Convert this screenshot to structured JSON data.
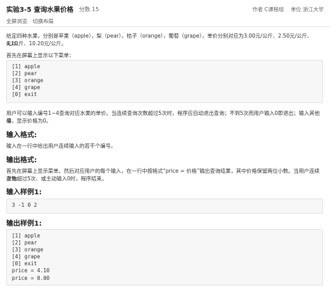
{
  "header": {
    "title": "实验3-5 查询水果价格",
    "score": "分数 15",
    "author": "作者 C课程组",
    "unit": "单位 浙江大学"
  },
  "actions": {
    "fullscreen": "全屏浏览",
    "switch_layout": "切换布局"
  },
  "problem": {
    "desc_line1": "给定四种水果，分别是苹果（apple），梨（pear），桔子（orange），葡萄（grape），单价分别对应为3.00元/公斤、2.50元/公斤、4.10",
    "desc_line2": "元/公斤、10.20元/公斤。",
    "menu_intro": "首先在屏幕上显示以下菜单：",
    "menu_lines": [
      "[1] apple",
      "[2] pear",
      "[3] orange",
      "[4] grape",
      "[0] exit"
    ],
    "rule_line1": "用户可以输入编号1~4查询对应水果的单价。当连续查询次数超过5次时，程序应自动退出查询；不到5次而用户输入0即退出；输入其他编",
    "rule_line2": "号，显示价格为0。",
    "input_format_title": "输入格式:",
    "input_format_text": "输入在一行中给出用户连续输入的若干个编号。",
    "output_format_title": "输出格式:",
    "output_format_line1": "首先在屏幕上显示菜单。然后对应用户的每个输入，在一行中按格式“price = 价格”输出查询结果，其中价格保留两位小数。当用户连续查询",
    "output_format_line2": "次数超过5次、或主动输入0时，程序结束。",
    "sample_input_title": "输入样例1:",
    "sample_input": "3 -1 0 2",
    "sample_output_title": "输出样例1:",
    "sample_output_lines": [
      "[1] apple",
      "[2] pear",
      "[3] orange",
      "[4] grape",
      "[0] exit",
      "price = 4.10",
      "price = 0.00"
    ]
  }
}
